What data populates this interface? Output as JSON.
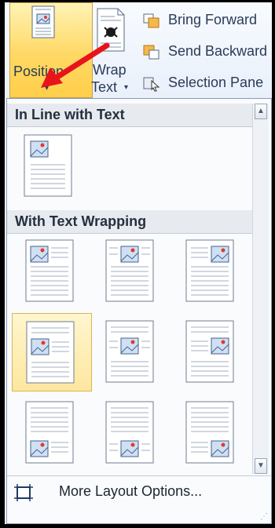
{
  "ribbon": {
    "position_label": "Position",
    "wrap_label_1": "Wrap",
    "wrap_label_2": "Text",
    "caret": "▾",
    "bring_forward": "Bring Forward",
    "send_backward": "Send Backward",
    "selection_pane": "Selection Pane"
  },
  "dropdown": {
    "section_inline": "In Line with Text",
    "section_wrapping": "With Text Wrapping",
    "selected_option": "middle-left",
    "more_options": "More Layout Options...",
    "scroll_up": "▲",
    "scroll_down": "▼",
    "grip": "⋰"
  },
  "colors": {
    "highlight": "#ffd864",
    "arrow": "#e8141c",
    "text": "#2a3b57"
  }
}
